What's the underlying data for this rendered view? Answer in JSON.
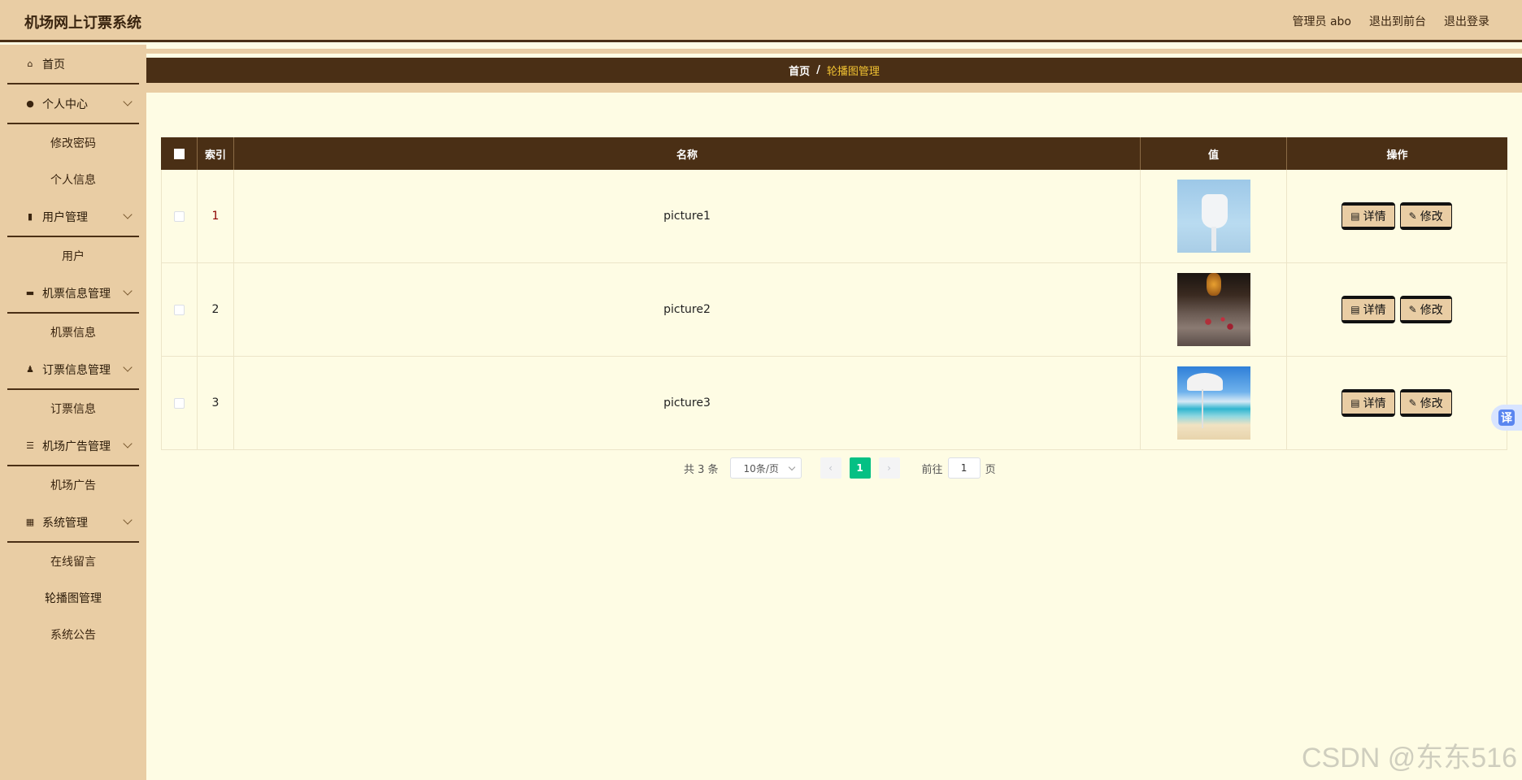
{
  "header": {
    "app_title": "机场网上订票系统",
    "admin_label": "管理员 abo",
    "exit_front": "退出到前台",
    "logout": "退出登录"
  },
  "sidebar": {
    "groups": [
      {
        "label": "首页",
        "icon": "home-icon",
        "subs": []
      },
      {
        "label": "个人中心",
        "icon": "user-icon",
        "subs": [
          "修改密码",
          "个人信息"
        ]
      },
      {
        "label": "用户管理",
        "icon": "document-icon",
        "subs": [
          "用户"
        ]
      },
      {
        "label": "机票信息管理",
        "icon": "briefcase-icon",
        "subs": [
          "机票信息"
        ]
      },
      {
        "label": "订票信息管理",
        "icon": "person-icon",
        "subs": [
          "订票信息"
        ]
      },
      {
        "label": "机场广告管理",
        "icon": "sliders-icon",
        "subs": [
          "机场广告"
        ]
      },
      {
        "label": "系统管理",
        "icon": "grid-icon",
        "subs": [
          "在线留言",
          "轮播图管理",
          "系统公告"
        ]
      }
    ]
  },
  "breadcrumb": {
    "home": "首页",
    "separator": "/",
    "current": "轮播图管理"
  },
  "table": {
    "headers": {
      "index": "索引",
      "name": "名称",
      "value": "值",
      "actions": "操作"
    },
    "rows": [
      {
        "index": "1",
        "name": "picture1",
        "thumb": "thumb1"
      },
      {
        "index": "2",
        "name": "picture2",
        "thumb": "thumb2"
      },
      {
        "index": "3",
        "name": "picture3",
        "thumb": "thumb3"
      }
    ],
    "detail_label": "详情",
    "edit_label": "修改"
  },
  "pagination": {
    "total": "共 3 条",
    "page_size": "10条/页",
    "current_page": "1",
    "goto_label": "前往",
    "goto_value": "1",
    "page_suffix": "页"
  },
  "floating": {
    "translate_label": "译"
  },
  "watermark": "CSDN @东东516",
  "colors": {
    "header_bg": "#e9cda4",
    "dark_brown": "#4a2f15",
    "content_bg": "#fefce4",
    "breadcrumb_current": "#f1c232",
    "pager_active": "#05c084"
  }
}
